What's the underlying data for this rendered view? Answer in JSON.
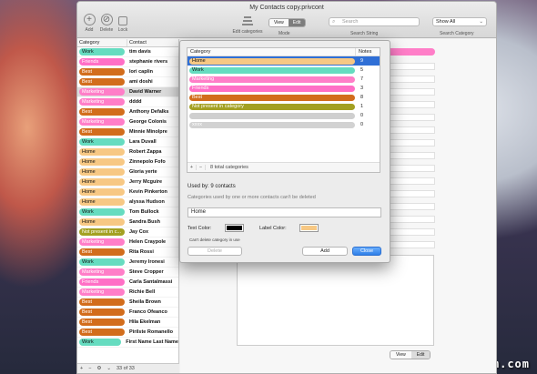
{
  "window": {
    "title": "My Contacts copy.privcont"
  },
  "toolbar": {
    "add_label": "Add",
    "delete_label": "Delete",
    "lock_label": "Lock",
    "edit_categories_label": "Edit categories",
    "mode_view": "View",
    "mode_edit": "Edit",
    "mode_label": "Mode",
    "search_placeholder": "Search",
    "search_label": "Search String",
    "category_select_value": "Show All",
    "search_category_label": "Search Category"
  },
  "list": {
    "header_category": "Category",
    "header_contact": "Contact",
    "rows": [
      {
        "category": "Work",
        "name": "tim davis",
        "color": "#66dcc0",
        "dark": true
      },
      {
        "category": "Friends",
        "name": "stephanie rivers",
        "color": "#ff6fc6",
        "dark": false
      },
      {
        "category": "Best",
        "name": "lori caplin",
        "color": "#d26d1c",
        "dark": false
      },
      {
        "category": "Best",
        "name": "ami doshi",
        "color": "#d26d1c",
        "dark": false
      },
      {
        "category": "Marketing",
        "name": "David Warner",
        "color": "#ff7ec8",
        "dark": false
      },
      {
        "category": "Marketing",
        "name": "dddd",
        "color": "#ff7ec8",
        "dark": false
      },
      {
        "category": "Best",
        "name": "Anthony Defalks",
        "color": "#d26d1c",
        "dark": false
      },
      {
        "category": "Marketing",
        "name": "George Colonis",
        "color": "#ff7ec8",
        "dark": false
      },
      {
        "category": "Best",
        "name": "Minnie Minolpre",
        "color": "#d26d1c",
        "dark": false
      },
      {
        "category": "Work",
        "name": "Lara Duvall",
        "color": "#66dcc0",
        "dark": true
      },
      {
        "category": "Home",
        "name": "Robert Zappa",
        "color": "#f7c884",
        "dark": true
      },
      {
        "category": "Home",
        "name": "Zinnepolo Fofo",
        "color": "#f7c884",
        "dark": true
      },
      {
        "category": "Home",
        "name": "Gloria yerte",
        "color": "#f7c884",
        "dark": true
      },
      {
        "category": "Home",
        "name": "Jerry Mcguire",
        "color": "#f7c884",
        "dark": true
      },
      {
        "category": "Home",
        "name": "Kevin Pinkerton",
        "color": "#f7c884",
        "dark": true
      },
      {
        "category": "Home",
        "name": "alyssa Hudson",
        "color": "#f7c884",
        "dark": true
      },
      {
        "category": "Work",
        "name": "Tom Bullock",
        "color": "#66dcc0",
        "dark": true
      },
      {
        "category": "Home",
        "name": "Sandra Bush",
        "color": "#f7c884",
        "dark": true
      },
      {
        "category": "Not present in c...",
        "name": "Jay Cox",
        "color": "#a3a022",
        "dark": false
      },
      {
        "category": "Marketing",
        "name": "Helen Craypole",
        "color": "#ff7ec8",
        "dark": false
      },
      {
        "category": "Best",
        "name": "Rita Rossi",
        "color": "#d26d1c",
        "dark": false
      },
      {
        "category": "Work",
        "name": "Jeremy Ironesi",
        "color": "#66dcc0",
        "dark": true
      },
      {
        "category": "Marketing",
        "name": "Steve Cropper",
        "color": "#ff7ec8",
        "dark": false
      },
      {
        "category": "Friends",
        "name": "Carla Santalmassi",
        "color": "#ff6fc6",
        "dark": false
      },
      {
        "category": "Marketing",
        "name": "Richie Bell",
        "color": "#ff7ec8",
        "dark": false
      },
      {
        "category": "Best",
        "name": "Sheila Brown",
        "color": "#d26d1c",
        "dark": false
      },
      {
        "category": "Best",
        "name": "Franco Ofeanco",
        "color": "#d26d1c",
        "dark": false
      },
      {
        "category": "Best",
        "name": "Hila Ekelman",
        "color": "#d26d1c",
        "dark": false
      },
      {
        "category": "Best",
        "name": "Pirilste Romanello",
        "color": "#d26d1c",
        "dark": false
      },
      {
        "category": "Work",
        "name": "First Name Last Name",
        "color": "#66dcc0",
        "dark": true
      }
    ],
    "footer_count": "33 of 33"
  },
  "detail": {
    "mode_view": "View",
    "mode_edit": "Edit"
  },
  "dialog": {
    "header_category": "Category",
    "header_notes": "Notes",
    "categories": [
      {
        "name": "Home",
        "notes": "9",
        "color": "#f7c884",
        "dark": true,
        "selected": true
      },
      {
        "name": "Work",
        "notes": "5",
        "color": "#66dcc0",
        "dark": true,
        "selected": false
      },
      {
        "name": "Marketing",
        "notes": "7",
        "color": "#ff7ec8",
        "dark": false,
        "selected": false
      },
      {
        "name": "Friends",
        "notes": "3",
        "color": "#ff6fc6",
        "dark": false,
        "selected": false
      },
      {
        "name": "Best",
        "notes": "8",
        "color": "#d26d1c",
        "dark": false,
        "selected": false
      },
      {
        "name": "Not present in category",
        "notes": "1",
        "color": "#a3a022",
        "dark": false,
        "selected": false
      },
      {
        "name": "",
        "notes": "0",
        "color": "#cfcfcf",
        "dark": false,
        "selected": false
      },
      {
        "name": "xxxx",
        "notes": "0",
        "color": "#d2d2d2",
        "dark": false,
        "selected": false
      }
    ],
    "total_label": "8 total categories",
    "used_by": "Used by:  9 contacts",
    "used_note": "Categories used by one or more contacts can't be deleted",
    "name_value": "Home",
    "text_color_label": "Text Color:",
    "text_color": "#000000",
    "label_color_label": "Label Color:",
    "label_color": "#f7c884",
    "cant_delete": "Can't delete category in use",
    "delete_label": "Delete",
    "add_label": "Add",
    "close_label": "Close"
  },
  "watermark": "www.mac-gm.com"
}
